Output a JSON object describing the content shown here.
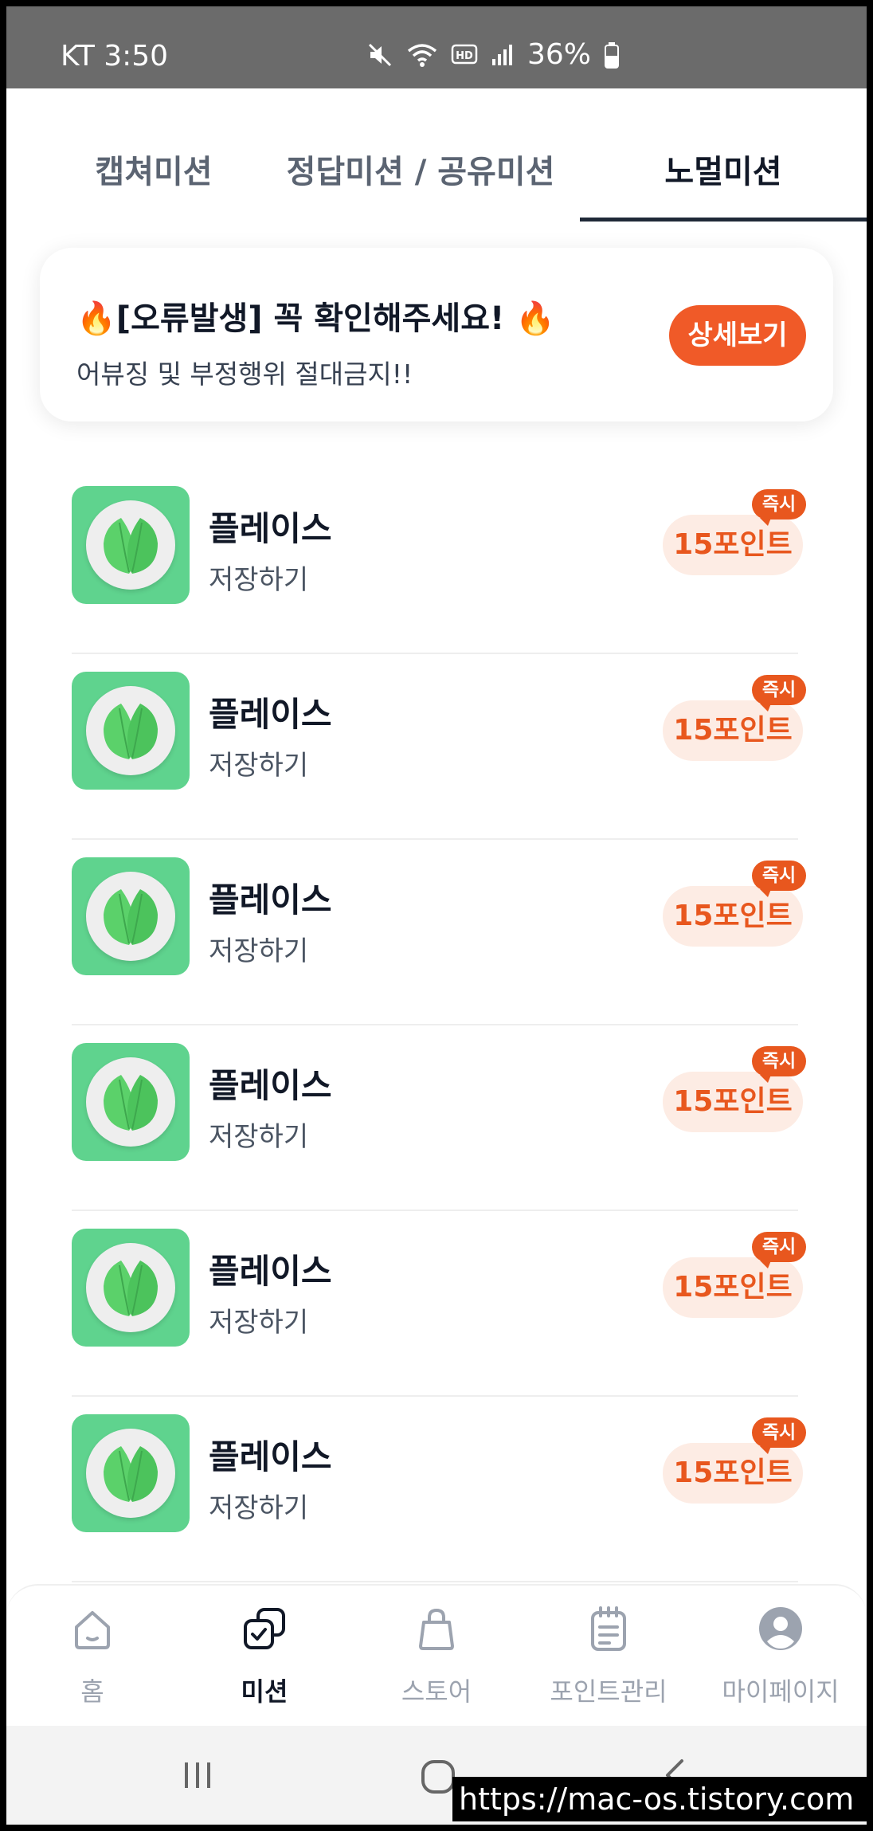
{
  "status_bar": {
    "carrier_time": "KT 3:50",
    "battery": "36%"
  },
  "tabs": [
    {
      "label": "캡쳐미션",
      "active": false
    },
    {
      "label": "정답미션 / 공유미션",
      "active": false
    },
    {
      "label": "노멀미션",
      "active": true
    }
  ],
  "notice": {
    "title": "[오류발생] 꼭 확인해주세요!",
    "fire_emoji": "🔥",
    "subtitle": "어뷰징 및 부정행위 절대금지!!",
    "detail_button": "상세보기"
  },
  "missions": [
    {
      "title": "플레이스",
      "subtitle": "저장하기",
      "points": "15포인트",
      "badge": "즉시"
    },
    {
      "title": "플레이스",
      "subtitle": "저장하기",
      "points": "15포인트",
      "badge": "즉시"
    },
    {
      "title": "플레이스",
      "subtitle": "저장하기",
      "points": "15포인트",
      "badge": "즉시"
    },
    {
      "title": "플레이스",
      "subtitle": "저장하기",
      "points": "15포인트",
      "badge": "즉시"
    },
    {
      "title": "플레이스",
      "subtitle": "저장하기",
      "points": "15포인트",
      "badge": "즉시"
    },
    {
      "title": "플레이스",
      "subtitle": "저장하기",
      "points": "15포인트",
      "badge": "즉시"
    }
  ],
  "bottom_nav": [
    {
      "label": "홈",
      "icon": "home-icon",
      "active": false
    },
    {
      "label": "미션",
      "icon": "mission-icon",
      "active": true
    },
    {
      "label": "스토어",
      "icon": "bag-icon",
      "active": false
    },
    {
      "label": "포인트관리",
      "icon": "notepad-icon",
      "active": false
    },
    {
      "label": "마이페이지",
      "icon": "profile-icon",
      "active": false
    }
  ],
  "watermark": "https://mac-os.tistory.com",
  "colors": {
    "accent": "#f05a28",
    "points_bg": "#fdece4",
    "thumb_green": "#5fd38e",
    "active_text": "#111827",
    "inactive_text": "#9ca3af"
  }
}
